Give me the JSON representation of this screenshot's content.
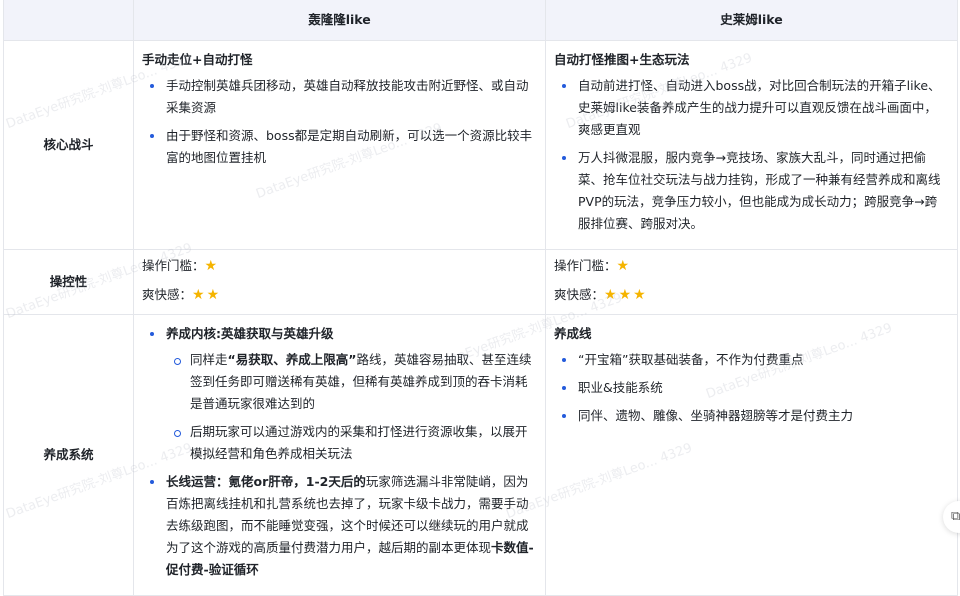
{
  "headers": [
    "",
    "轰隆隆like",
    "史莱姆like"
  ],
  "watermark": "DataEye研究院-刘尊Leo... 4329",
  "rows": {
    "combat": {
      "label": "核心战斗",
      "a": {
        "title": "手动走位+自动打怪",
        "items": [
          "手动控制英雄兵团移动，英雄自动释放技能攻击附近野怪、或自动采集资源",
          "由于野怪和资源、boss都是定期自动刷新，可以选一个资源比较丰富的地图位置挂机"
        ]
      },
      "b": {
        "title": "自动打怪推图+生态玩法",
        "items": [
          "自动前进打怪、自动进入boss战，对比回合制玩法的开箱子like、史莱姆like装备养成产生的战力提升可以直观反馈在战斗画面中，爽感更直观",
          "万人抖微混服，服内竞争→竞技场、家族大乱斗，同时通过把偷菜、抢车位社交玩法与战力挂钩，形成了一种兼有经营养成和离线PVP的玩法，竞争压力较小，但也能成为成长动力；跨服竞争→跨服排位赛、跨服对决。"
        ]
      }
    },
    "control": {
      "label": "操控性",
      "a": {
        "threshold": "操作门槛：",
        "threshold_stars": 1,
        "fun": "爽快感：",
        "fun_stars": 2
      },
      "b": {
        "threshold": "操作门槛：",
        "threshold_stars": 1,
        "fun": "爽快感：",
        "fun_stars": 3
      }
    },
    "growth": {
      "label": "养成系统",
      "a": {
        "core": "养成内核:英雄获取与英雄升级",
        "sub1_pre": "同样走",
        "sub1_bold": "“易获取、养成上限高”",
        "sub1_post": "路线，英雄容易抽取、甚至连续签到任务即可赠送稀有英雄，但稀有英雄养成到顶的吞卡消耗是普通玩家很难达到的",
        "sub2": "后期玩家可以通过游戏内的采集和打怪进行资源收集，以展开模拟经营和角色养成相关玩法",
        "long_bold": "长线运营：氪佬or肝帝，1-2天后的",
        "long_text": "玩家筛选漏斗非常陡峭，因为百炼把离线挂机和扎营系统也去掉了，玩家卡级卡战力，需要手动去练级跑图，而不能睡觉变强，这个时候还可以继续玩的用户就成为了这个游戏的高质量付费潜力用户，越后期的副本更体现",
        "long_end": "卡数值-促付费-验证循环"
      },
      "b": {
        "title": "养成线",
        "items": [
          "“开宝箱”获取基础装备，不作为付费重点",
          "职业&技能系统",
          "同伴、遗物、雕像、坐骑神器翅膀等才是付费主力"
        ]
      }
    }
  },
  "star_glyph": "★",
  "float_button_icon": "copy-icon"
}
